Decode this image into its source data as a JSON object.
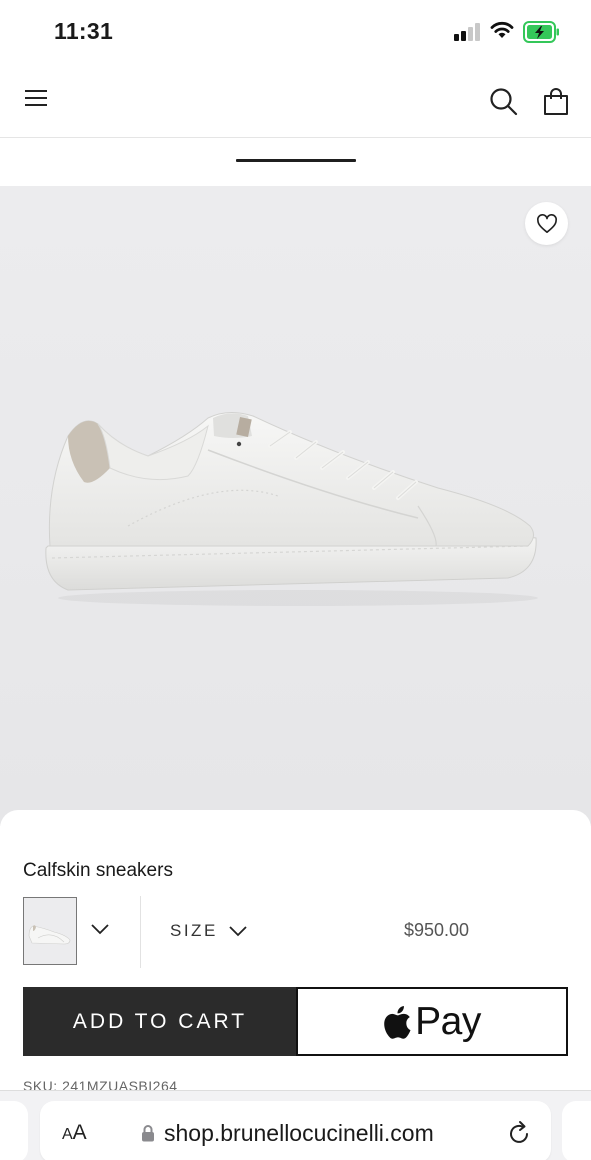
{
  "status_bar": {
    "time": "11:31",
    "signal_bars_active": 2,
    "signal_bars_total": 4,
    "battery_color": "#34c759",
    "charging": true
  },
  "header": {
    "menu_icon": "hamburger-menu-icon",
    "search_icon": "search-icon",
    "bag_icon": "shopping-bag-icon"
  },
  "gallery": {
    "wishlist_icon": "heart-icon",
    "image_subject": "white calfskin sneaker"
  },
  "product": {
    "name": "Calfskin sneakers",
    "size_label": "SIZE",
    "price": "$950.00",
    "sku": "SKU: 241MZUASBI264"
  },
  "actions": {
    "add_to_cart_label": "ADD TO CART",
    "apple_pay_label": "Pay"
  },
  "browser": {
    "text_size_label": "A",
    "text_size_label_small": "A",
    "url": "shop.brunellocucinelli.com",
    "reload_icon": "reload-icon"
  },
  "colors": {
    "button_dark": "#2b2b2b",
    "gallery_bg": "#e9e9eb",
    "price_text": "#555555"
  }
}
